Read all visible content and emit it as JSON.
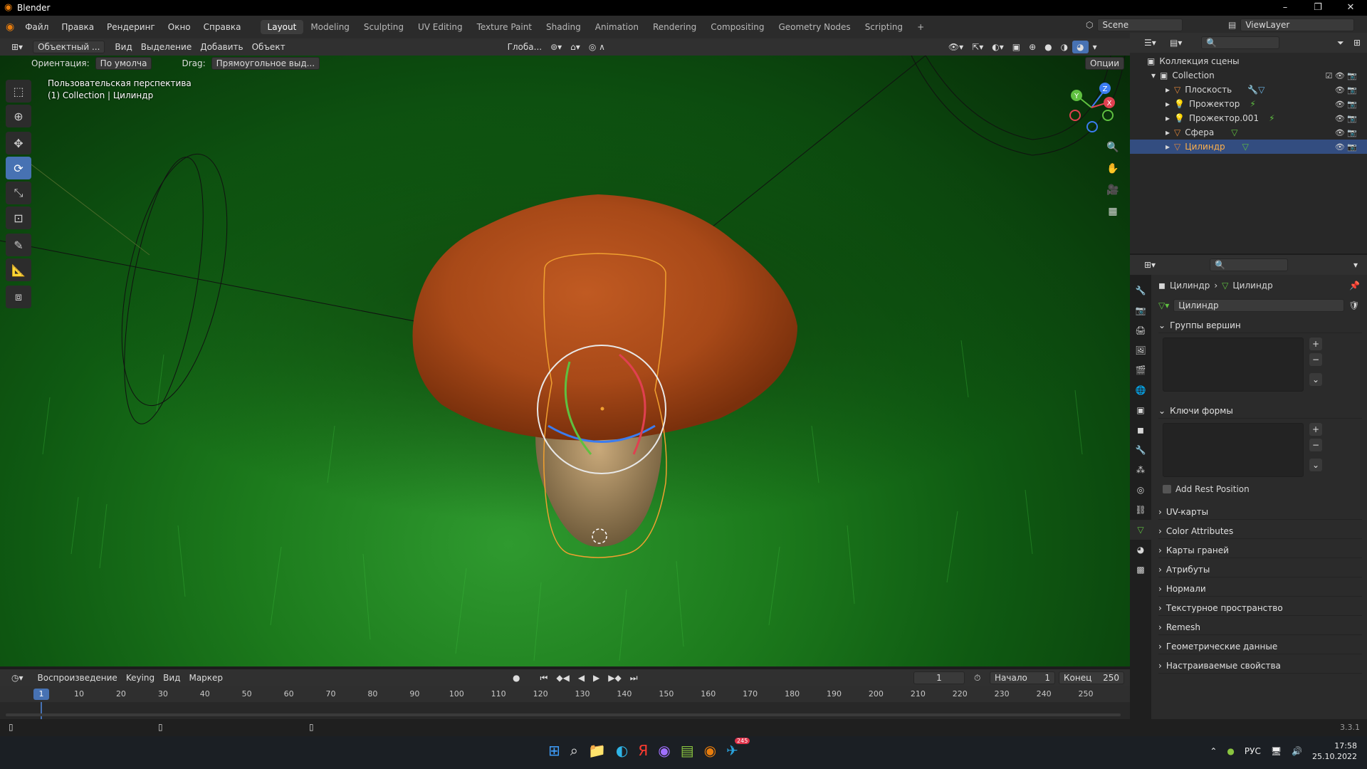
{
  "window": {
    "title": "Blender",
    "controls": [
      "–",
      "❐",
      "✕"
    ]
  },
  "menu": {
    "items": [
      "Файл",
      "Правка",
      "Рендеринг",
      "Окно",
      "Справка"
    ]
  },
  "workspaces": [
    "Layout",
    "Modeling",
    "Sculpting",
    "UV Editing",
    "Texture Paint",
    "Shading",
    "Animation",
    "Rendering",
    "Compositing",
    "Geometry Nodes",
    "Scripting"
  ],
  "scene": {
    "name": "Scene",
    "view_layer": "ViewLayer"
  },
  "viewport_header": {
    "mode": "Объектный ...",
    "menus": [
      "Вид",
      "Выделение",
      "Добавить",
      "Объект"
    ],
    "transform": "Глоба..."
  },
  "viewport_sub": {
    "orientation_label": "Ориентация:",
    "orientation_value": "По умолча",
    "drag_label": "Drag:",
    "drag_value": "Прямоугольное выд...",
    "options": "Опции"
  },
  "viewport_overlay": {
    "line1": "Пользовательская перспектива",
    "line2": "(1) Collection | Цилиндр"
  },
  "gizmo_axes": {
    "x": "X",
    "y": "Y",
    "z": "Z"
  },
  "outliner": {
    "root": "Коллекция сцены",
    "collection": "Collection",
    "items": [
      {
        "name": "Плоскость",
        "selected": false,
        "color": "#e0873a"
      },
      {
        "name": "Прожектор",
        "selected": false,
        "color": "#e0873a"
      },
      {
        "name": "Прожектор.001",
        "selected": false,
        "color": "#e0873a"
      },
      {
        "name": "Сфера",
        "selected": false,
        "color": "#e0873a"
      },
      {
        "name": "Цилиндр",
        "selected": true,
        "color": "#e0873a"
      }
    ]
  },
  "properties": {
    "breadcrumb_object": "Цилиндр",
    "breadcrumb_data": "Цилиндр",
    "mesh_name": "Цилиндр",
    "vertex_groups": "Группы вершин",
    "shape_keys": "Ключи формы",
    "add_rest_position": "Add Rest Position",
    "panels": [
      "UV-карты",
      "Color Attributes",
      "Карты граней",
      "Атрибуты",
      "Нормали",
      "Текстурное пространство",
      "Remesh",
      "Геометрические данные",
      "Настраиваемые свойства"
    ]
  },
  "timeline": {
    "menus": [
      "Воспроизведение",
      "Keying",
      "Вид",
      "Маркер"
    ],
    "current_frame": "1",
    "start_label": "Начало",
    "start": "1",
    "end_label": "Конец",
    "end": "250",
    "ticks": [
      "10",
      "20",
      "30",
      "40",
      "50",
      "60",
      "70",
      "80",
      "90",
      "100",
      "110",
      "120",
      "130",
      "140",
      "150",
      "160",
      "170",
      "180",
      "190",
      "200",
      "210",
      "220",
      "230",
      "240",
      "250"
    ]
  },
  "status": {
    "version": "3.3.1"
  },
  "taskbar": {
    "lang": "РУС",
    "time": "17:58",
    "date": "25.10.2022",
    "badge": "245"
  },
  "colors": {
    "accent": "#4772b3",
    "selection": "#334d80",
    "mushroom_cap": "#b04e1c",
    "grass": "#1c7a1c"
  }
}
